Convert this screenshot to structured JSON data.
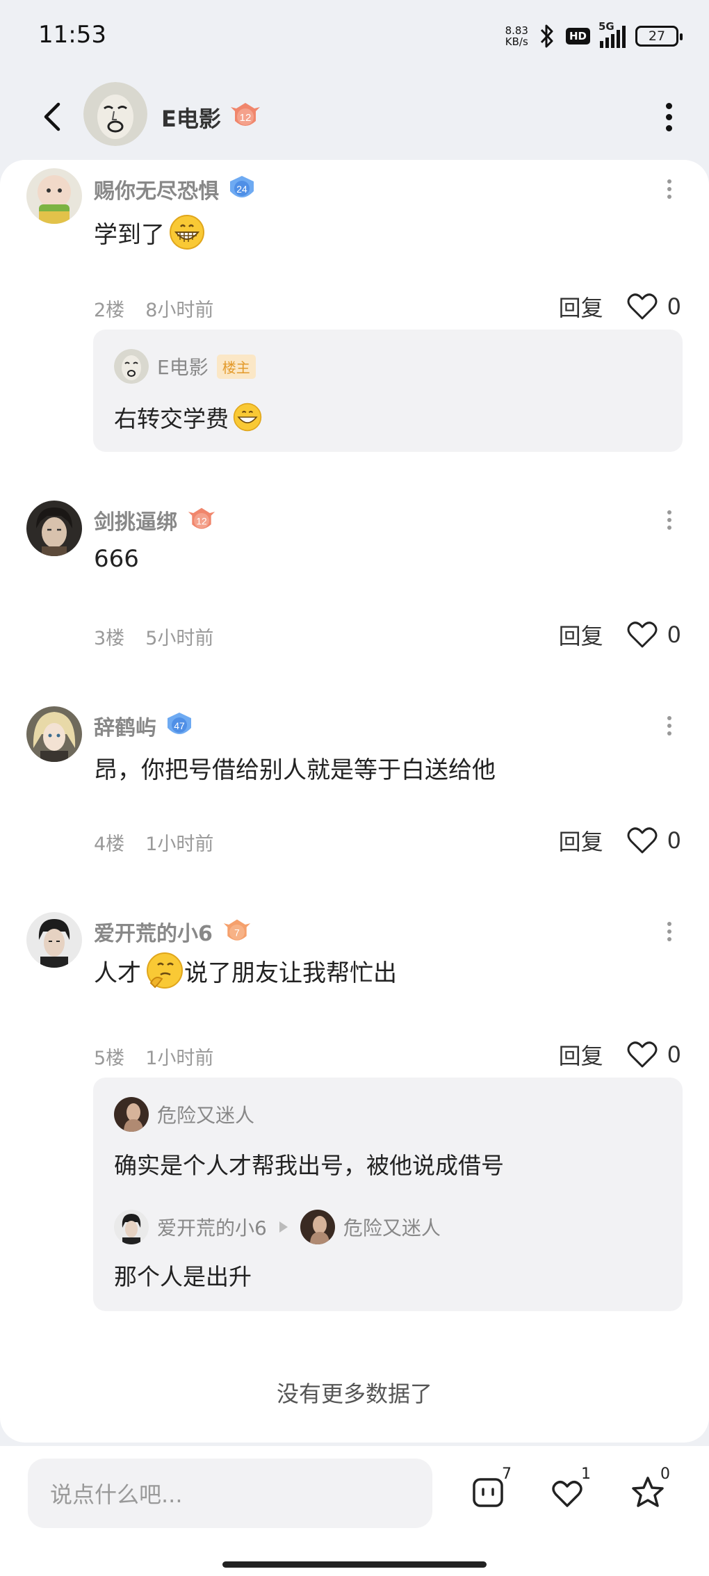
{
  "status_bar": {
    "time": "11:53",
    "net_speed_value": "8.83",
    "net_speed_unit": "KB/s",
    "hd": "HD",
    "network": "5G",
    "battery": "27"
  },
  "header": {
    "title": "E电影",
    "level": "12"
  },
  "comments": [
    {
      "name": "赐你无尽恐惧",
      "level": "24",
      "badge_color": "#5aa0f0",
      "text": "学到了",
      "floor": "2楼",
      "time": "8小时前",
      "reply_label": "回复",
      "likes": "0",
      "replies": [
        {
          "name": "E电影",
          "badge": "楼主",
          "text": "右转交学费"
        }
      ]
    },
    {
      "name": "剑挑逼绑",
      "level": "12",
      "badge_color": "#f07a63",
      "text": "666",
      "floor": "3楼",
      "time": "5小时前",
      "reply_label": "回复",
      "likes": "0"
    },
    {
      "name": "辞鹤屿",
      "level": "47",
      "badge_color": "#5aa0f0",
      "text": "昂，你把号借给别人就是等于白送给他",
      "floor": "4楼",
      "time": "1小时前",
      "reply_label": "回复",
      "likes": "0"
    },
    {
      "name": "爱开荒的小6",
      "level": "7",
      "badge_color": "#f58d5a",
      "text_before": "人才",
      "text_after": "说了朋友让我帮忙出",
      "floor": "5楼",
      "time": "1小时前",
      "reply_label": "回复",
      "likes": "0",
      "replies": [
        {
          "name": "危险又迷人",
          "text": "确实是个人才帮我出号，被他说成借号"
        },
        {
          "from": "爱开荒的小6",
          "to": "危险又迷人",
          "text": "那个人是出升"
        }
      ]
    }
  ],
  "no_more": "没有更多数据了",
  "bottom_bar": {
    "placeholder": "说点什么吧...",
    "comment_count": "7",
    "like_count": "1",
    "star_count": "0"
  },
  "colors": {
    "background": "#eef0f4",
    "card": "#ffffff",
    "reply_box": "#f2f2f4",
    "op_badge_bg": "#fbe7c6",
    "op_badge_text": "#e39a2b"
  }
}
